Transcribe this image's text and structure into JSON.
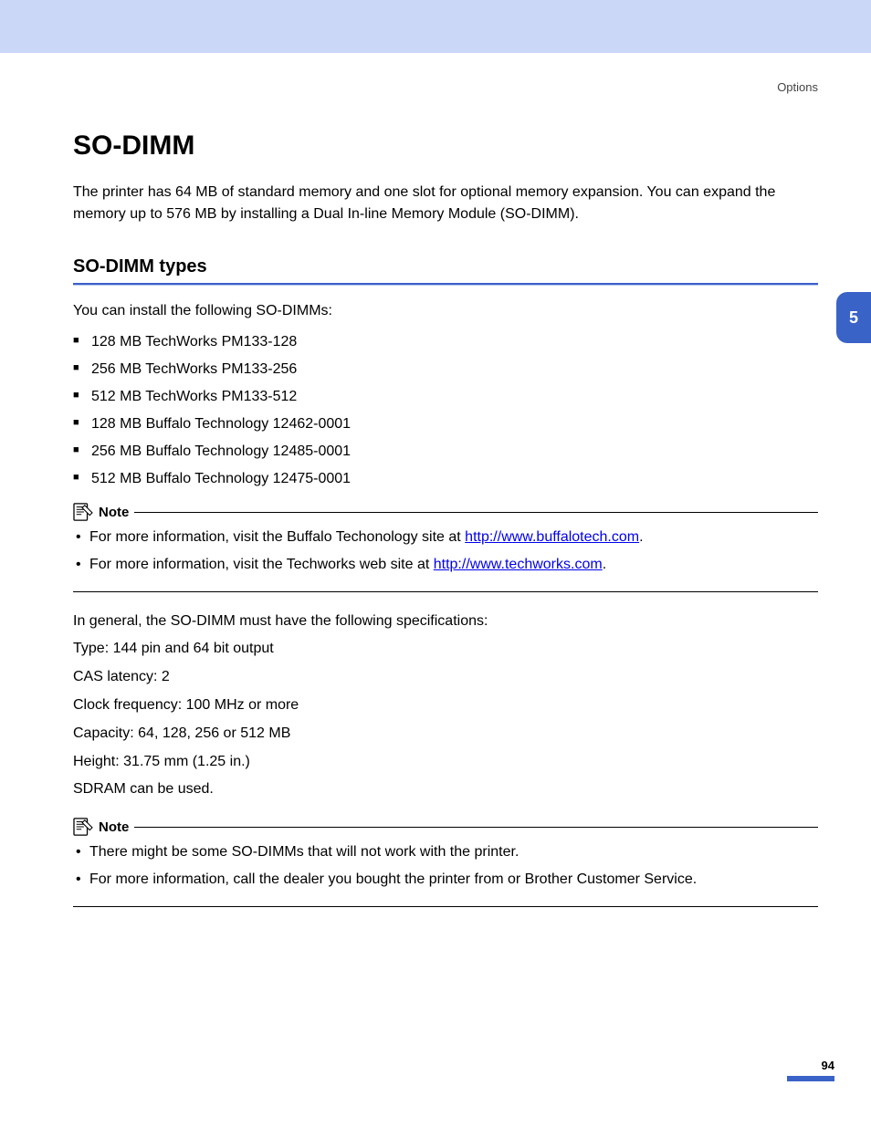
{
  "running_head": "Options",
  "title": "SO-DIMM",
  "intro": "The printer has 64 MB of standard memory and one slot for optional memory expansion. You can expand the memory up to 576 MB by installing a Dual In-line Memory Module (SO-DIMM).",
  "section_heading": "SO-DIMM types",
  "types_intro": "You can install the following SO-DIMMs:",
  "dimm_list": [
    "128 MB TechWorks PM133-128",
    "256 MB TechWorks PM133-256",
    "512 MB TechWorks PM133-512",
    "128 MB Buffalo Technology 12462-0001",
    "256 MB Buffalo Technology 12485-0001",
    "512 MB Buffalo Technology 12475-0001"
  ],
  "note_label": "Note",
  "note1": {
    "items": [
      {
        "pre": "For more information, visit the Buffalo Techonology site at ",
        "url": "http://www.buffalotech.com",
        "post": "."
      },
      {
        "pre": "For more information, visit the Techworks web site at ",
        "url": "http://www.techworks.com",
        "post": "."
      }
    ]
  },
  "specs_intro": "In general, the SO-DIMM must have the following specifications:",
  "specs": [
    "Type: 144 pin and 64 bit output",
    "CAS latency: 2",
    "Clock frequency: 100 MHz or more",
    "Capacity: 64, 128, 256 or 512 MB",
    "Height: 31.75 mm (1.25 in.)",
    "SDRAM can be used."
  ],
  "note2": {
    "items": [
      "There might be some SO-DIMMs that will not work with the printer.",
      "For more information, call the dealer you bought the printer from or Brother Customer Service."
    ]
  },
  "chapter_tab": "5",
  "page_number": "94"
}
